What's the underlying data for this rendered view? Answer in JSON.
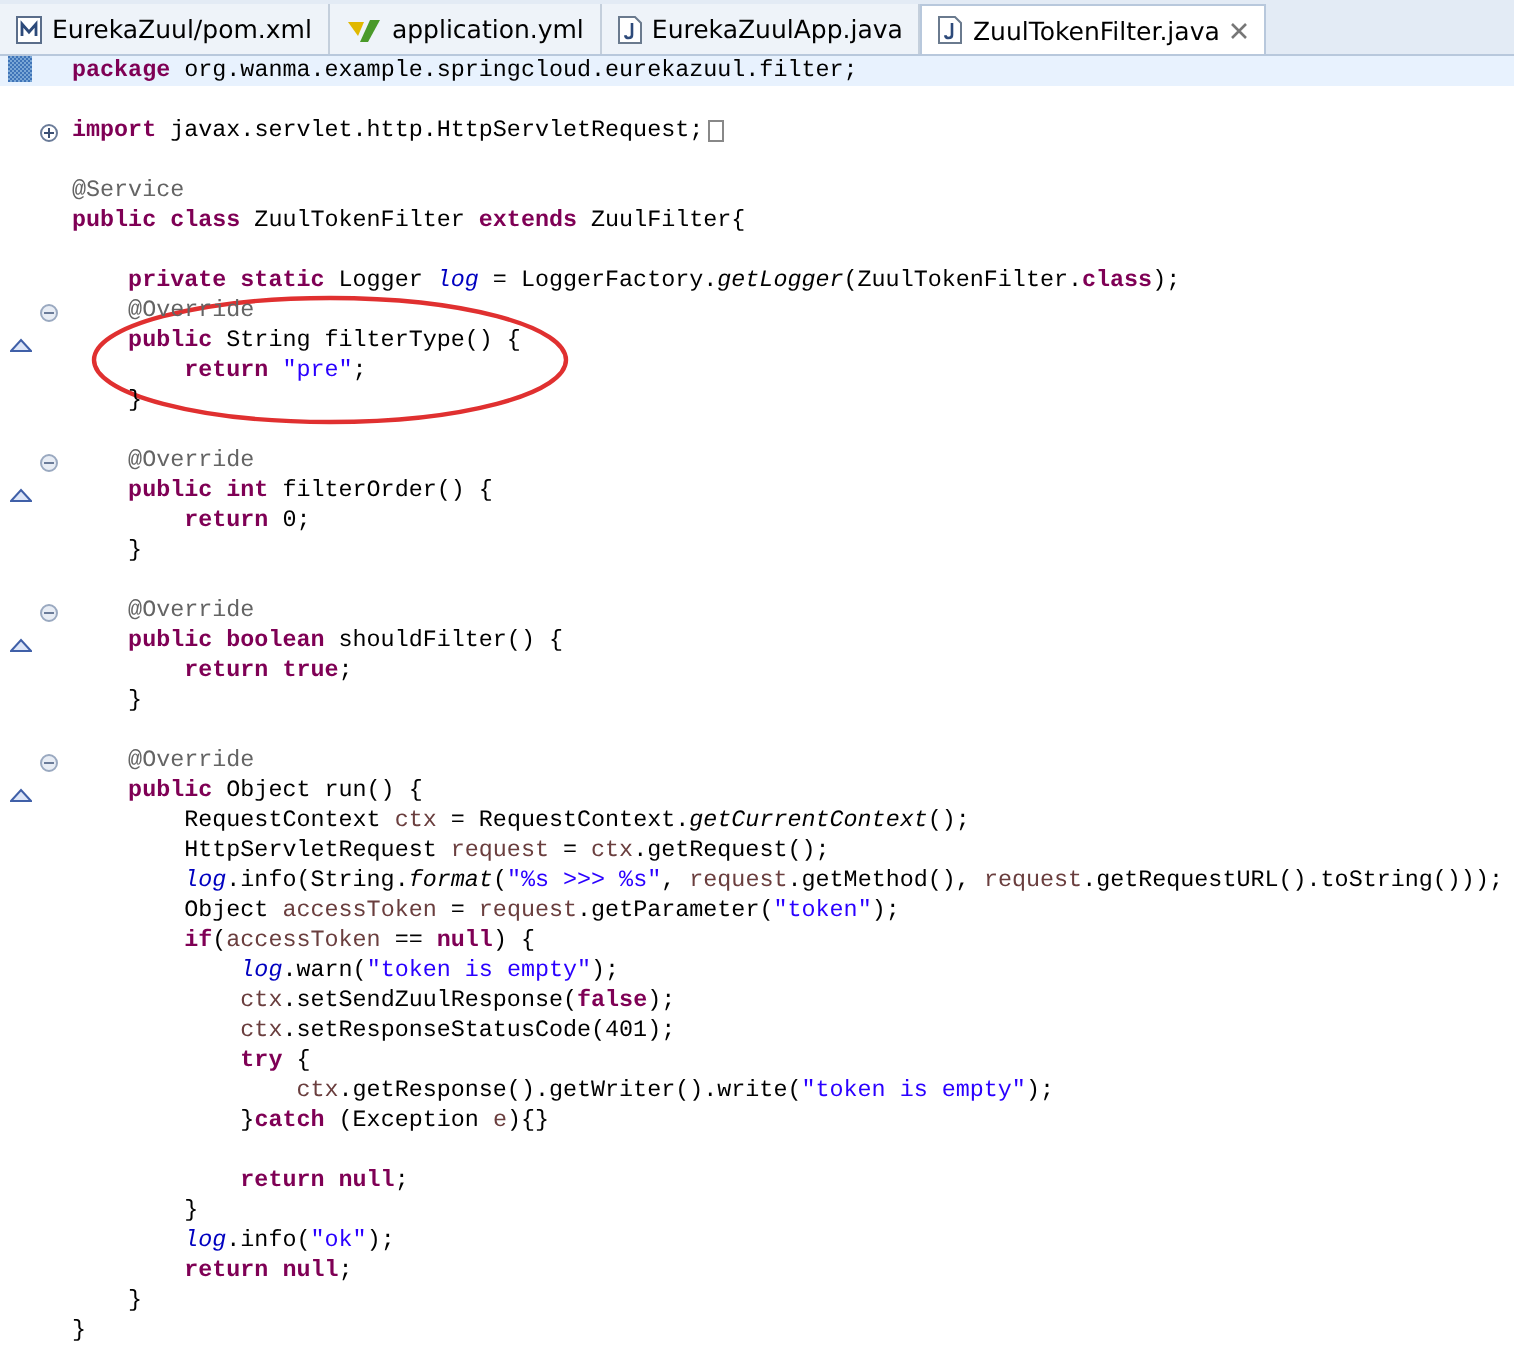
{
  "tabs": [
    {
      "label": "EurekaZuul/pom.xml",
      "kind": "maven",
      "selected": false
    },
    {
      "label": "application.yml",
      "kind": "yaml",
      "selected": false
    },
    {
      "label": "EurekaZuulApp.java",
      "kind": "java",
      "selected": false
    },
    {
      "label": "ZuulTokenFilter.java",
      "kind": "java",
      "selected": true
    }
  ],
  "editor": {
    "lines": [
      {
        "current": true,
        "changed": true,
        "tokens": [
          {
            "kind": "k",
            "text": "package"
          },
          {
            "kind": "p",
            "text": " org.wanma.example.springcloud.eurekazuul.filter;"
          }
        ]
      },
      {
        "current": false
      },
      {
        "current": false,
        "foldable": true,
        "expanded": false,
        "tokens": [
          {
            "kind": "k",
            "text": "import"
          },
          {
            "kind": "p",
            "text": " javax.servlet.http.HttpServletRequest;"
          }
        ]
      },
      {
        "current": false
      },
      {
        "current": false,
        "tokens": [
          {
            "kind": "a",
            "text": "@Service"
          }
        ]
      },
      {
        "current": false,
        "tokens": [
          {
            "kind": "k",
            "text": "public class"
          },
          {
            "kind": "p",
            "text": " ZuulTokenFilter "
          },
          {
            "kind": "k",
            "text": "extends"
          },
          {
            "kind": "p",
            "text": " ZuulFilter{"
          }
        ]
      },
      {
        "current": false
      },
      {
        "current": false,
        "tokens": [
          {
            "kind": "k",
            "text": "    private static"
          },
          {
            "kind": "p",
            "text": " Logger "
          },
          {
            "kind": "f",
            "text": "log"
          },
          {
            "kind": "p",
            "text": " = LoggerFactory."
          },
          {
            "kind": "i",
            "text": "getLogger"
          },
          {
            "kind": "p",
            "text": "(ZuulTokenFilter."
          },
          {
            "kind": "k",
            "text": "class"
          },
          {
            "kind": "p",
            "text": ");"
          }
        ]
      },
      {
        "current": false,
        "foldable": true,
        "expanded": true,
        "tokens": [
          {
            "kind": "a",
            "text": "    @Override"
          }
        ]
      },
      {
        "current": false,
        "override": true,
        "tokens": [
          {
            "kind": "k",
            "text": "    public"
          },
          {
            "kind": "p",
            "text": " String filterType() {"
          }
        ]
      },
      {
        "current": false,
        "tokens": [
          {
            "kind": "k",
            "text": "        return"
          },
          {
            "kind": "s",
            "text": " \"pre\""
          },
          {
            "kind": "p",
            "text": ";"
          }
        ]
      },
      {
        "current": false,
        "tokens": [
          {
            "kind": "p",
            "text": "    }"
          }
        ]
      },
      {
        "current": false
      },
      {
        "current": false,
        "foldable": true,
        "expanded": true,
        "tokens": [
          {
            "kind": "a",
            "text": "    @Override"
          }
        ]
      },
      {
        "current": false,
        "override": true,
        "tokens": [
          {
            "kind": "k",
            "text": "    public int"
          },
          {
            "kind": "p",
            "text": " filterOrder() {"
          }
        ]
      },
      {
        "current": false,
        "tokens": [
          {
            "kind": "k",
            "text": "        return"
          },
          {
            "kind": "p",
            "text": " 0;"
          }
        ]
      },
      {
        "current": false,
        "tokens": [
          {
            "kind": "p",
            "text": "    }"
          }
        ]
      },
      {
        "current": false
      },
      {
        "current": false,
        "foldable": true,
        "expanded": true,
        "tokens": [
          {
            "kind": "a",
            "text": "    @Override"
          }
        ]
      },
      {
        "current": false,
        "override": true,
        "tokens": [
          {
            "kind": "k",
            "text": "    public boolean"
          },
          {
            "kind": "p",
            "text": " shouldFilter() {"
          }
        ]
      },
      {
        "current": false,
        "tokens": [
          {
            "kind": "k",
            "text": "        return true"
          },
          {
            "kind": "p",
            "text": ";"
          }
        ]
      },
      {
        "current": false,
        "tokens": [
          {
            "kind": "p",
            "text": "    }"
          }
        ]
      },
      {
        "current": false
      },
      {
        "current": false,
        "foldable": true,
        "expanded": true,
        "tokens": [
          {
            "kind": "a",
            "text": "    @Override"
          }
        ]
      },
      {
        "current": false,
        "override": true,
        "tokens": [
          {
            "kind": "k",
            "text": "    public"
          },
          {
            "kind": "p",
            "text": " Object run() {"
          }
        ]
      },
      {
        "current": false,
        "tokens": [
          {
            "kind": "p",
            "text": "        RequestContext "
          },
          {
            "kind": "v",
            "text": "ctx"
          },
          {
            "kind": "p",
            "text": " = RequestContext."
          },
          {
            "kind": "i",
            "text": "getCurrentContext"
          },
          {
            "kind": "p",
            "text": "();"
          }
        ]
      },
      {
        "current": false,
        "tokens": [
          {
            "kind": "p",
            "text": "        HttpServletRequest "
          },
          {
            "kind": "v",
            "text": "request"
          },
          {
            "kind": "p",
            "text": " = "
          },
          {
            "kind": "v",
            "text": "ctx"
          },
          {
            "kind": "p",
            "text": ".getRequest();"
          }
        ]
      },
      {
        "current": false,
        "tokens": [
          {
            "kind": "f",
            "text": "        log"
          },
          {
            "kind": "p",
            "text": ".info(String."
          },
          {
            "kind": "i",
            "text": "format"
          },
          {
            "kind": "p",
            "text": "("
          },
          {
            "kind": "s",
            "text": "\"%s >>> %s\""
          },
          {
            "kind": "p",
            "text": ", "
          },
          {
            "kind": "v",
            "text": "request"
          },
          {
            "kind": "p",
            "text": ".getMethod(), "
          },
          {
            "kind": "v",
            "text": "request"
          },
          {
            "kind": "p",
            "text": ".getRequestURL().toString()));"
          }
        ]
      },
      {
        "current": false,
        "tokens": [
          {
            "kind": "p",
            "text": "        Object "
          },
          {
            "kind": "v",
            "text": "accessToken"
          },
          {
            "kind": "p",
            "text": " = "
          },
          {
            "kind": "v",
            "text": "request"
          },
          {
            "kind": "p",
            "text": ".getParameter("
          },
          {
            "kind": "s",
            "text": "\"token\""
          },
          {
            "kind": "p",
            "text": ");"
          }
        ]
      },
      {
        "current": false,
        "tokens": [
          {
            "kind": "k",
            "text": "        if"
          },
          {
            "kind": "p",
            "text": "("
          },
          {
            "kind": "v",
            "text": "accessToken"
          },
          {
            "kind": "p",
            "text": " == "
          },
          {
            "kind": "k",
            "text": "null"
          },
          {
            "kind": "p",
            "text": ") {"
          }
        ]
      },
      {
        "current": false,
        "tokens": [
          {
            "kind": "f",
            "text": "            log"
          },
          {
            "kind": "p",
            "text": ".warn("
          },
          {
            "kind": "s",
            "text": "\"token is empty\""
          },
          {
            "kind": "p",
            "text": ");"
          }
        ]
      },
      {
        "current": false,
        "tokens": [
          {
            "kind": "v",
            "text": "            ctx"
          },
          {
            "kind": "p",
            "text": ".setSendZuulResponse("
          },
          {
            "kind": "k",
            "text": "false"
          },
          {
            "kind": "p",
            "text": ");"
          }
        ]
      },
      {
        "current": false,
        "tokens": [
          {
            "kind": "v",
            "text": "            ctx"
          },
          {
            "kind": "p",
            "text": ".setResponseStatusCode(401);"
          }
        ]
      },
      {
        "current": false,
        "tokens": [
          {
            "kind": "k",
            "text": "            try"
          },
          {
            "kind": "p",
            "text": " {"
          }
        ]
      },
      {
        "current": false,
        "tokens": [
          {
            "kind": "v",
            "text": "                ctx"
          },
          {
            "kind": "p",
            "text": ".getResponse().getWriter().write("
          },
          {
            "kind": "s",
            "text": "\"token is empty\""
          },
          {
            "kind": "p",
            "text": ");"
          }
        ]
      },
      {
        "current": false,
        "tokens": [
          {
            "kind": "p",
            "text": "            }"
          },
          {
            "kind": "k",
            "text": "catch"
          },
          {
            "kind": "p",
            "text": " (Exception "
          },
          {
            "kind": "v",
            "text": "e"
          },
          {
            "kind": "p",
            "text": "){}"
          }
        ]
      },
      {
        "current": false
      },
      {
        "current": false,
        "tokens": [
          {
            "kind": "k",
            "text": "            return null"
          },
          {
            "kind": "p",
            "text": ";"
          }
        ]
      },
      {
        "current": false,
        "tokens": [
          {
            "kind": "p",
            "text": "        }"
          }
        ]
      },
      {
        "current": false,
        "tokens": [
          {
            "kind": "f",
            "text": "        log"
          },
          {
            "kind": "p",
            "text": ".info("
          },
          {
            "kind": "s",
            "text": "\"ok\""
          },
          {
            "kind": "p",
            "text": ");"
          }
        ]
      },
      {
        "current": false,
        "tokens": [
          {
            "kind": "k",
            "text": "        return null"
          },
          {
            "kind": "p",
            "text": ";"
          }
        ]
      },
      {
        "current": false,
        "tokens": [
          {
            "kind": "p",
            "text": "    }"
          }
        ]
      },
      {
        "current": false,
        "tokens": [
          {
            "kind": "p",
            "text": "}"
          }
        ]
      }
    ]
  }
}
